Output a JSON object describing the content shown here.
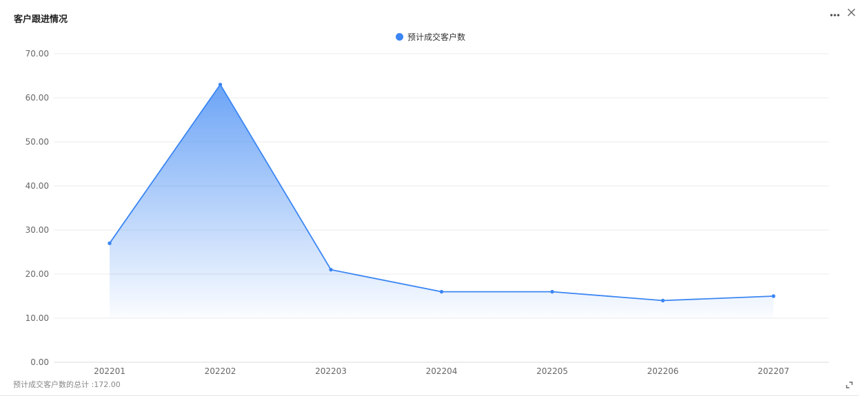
{
  "panel": {
    "title": "客户跟进情况",
    "icons": {
      "more": "more-horizontal-icon",
      "close": "close-icon",
      "expand": "expand-corner-icon"
    },
    "total_text": "预计成交客户数的总计 :172.00"
  },
  "colors": {
    "series": "#3b86f3",
    "grid": "#ebebeb",
    "axis_text": "#666666"
  },
  "chart_data": {
    "type": "area",
    "categories": [
      "202201",
      "202202",
      "202203",
      "202204",
      "202205",
      "202206",
      "202207"
    ],
    "series": [
      {
        "name": "预计成交客户数",
        "values": [
          27,
          63,
          21,
          16,
          16,
          14,
          15
        ]
      }
    ],
    "ylim": [
      0,
      70
    ],
    "yticks": [
      "0.00",
      "10.00",
      "20.00",
      "30.00",
      "40.00",
      "50.00",
      "60.00",
      "70.00"
    ],
    "title": "",
    "xlabel": "",
    "ylabel": "",
    "grid": true,
    "legend_position": "top-center"
  }
}
